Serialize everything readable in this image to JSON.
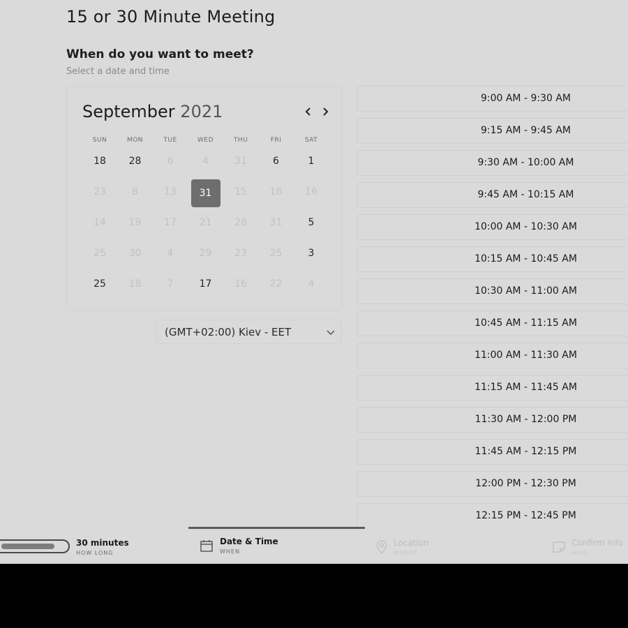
{
  "page": {
    "title": "15 or 30 Minute Meeting",
    "subtitle": "When do you want to meet?",
    "hint": "Select a date and time"
  },
  "calendar": {
    "month": "September",
    "year": "2021",
    "prev_icon": "chevron-left-icon",
    "next_icon": "chevron-right-icon",
    "days_of_week": [
      "SUN",
      "MON",
      "TUE",
      "WED",
      "THU",
      "FRI",
      "SAT"
    ],
    "weeks": [
      [
        {
          "label": "18",
          "state": "active"
        },
        {
          "label": "28",
          "state": "active"
        },
        {
          "label": "6",
          "state": "dim"
        },
        {
          "label": "4",
          "state": "dim"
        },
        {
          "label": "31",
          "state": "dim"
        },
        {
          "label": "6",
          "state": "active"
        },
        {
          "label": "1",
          "state": "active"
        }
      ],
      [
        {
          "label": "23",
          "state": "dim"
        },
        {
          "label": "8",
          "state": "dim"
        },
        {
          "label": "13",
          "state": "dim"
        },
        {
          "label": "31",
          "state": "selected"
        },
        {
          "label": "15",
          "state": "dim"
        },
        {
          "label": "16",
          "state": "dim"
        },
        {
          "label": "16",
          "state": "dim"
        }
      ],
      [
        {
          "label": "14",
          "state": "dim"
        },
        {
          "label": "19",
          "state": "dim"
        },
        {
          "label": "17",
          "state": "dim"
        },
        {
          "label": "21",
          "state": "dim"
        },
        {
          "label": "28",
          "state": "dim"
        },
        {
          "label": "31",
          "state": "dim"
        },
        {
          "label": "5",
          "state": "active"
        }
      ],
      [
        {
          "label": "25",
          "state": "dim"
        },
        {
          "label": "30",
          "state": "dim"
        },
        {
          "label": "4",
          "state": "dim"
        },
        {
          "label": "29",
          "state": "dim"
        },
        {
          "label": "23",
          "state": "dim"
        },
        {
          "label": "25",
          "state": "dim"
        },
        {
          "label": "3",
          "state": "active"
        }
      ],
      [
        {
          "label": "25",
          "state": "active"
        },
        {
          "label": "18",
          "state": "dim"
        },
        {
          "label": "7",
          "state": "dim"
        },
        {
          "label": "17",
          "state": "active"
        },
        {
          "label": "16",
          "state": "dim"
        },
        {
          "label": "22",
          "state": "dim"
        },
        {
          "label": "4",
          "state": "dim"
        }
      ]
    ]
  },
  "timezone": {
    "value": "(GMT+02:00) Kiev - EET",
    "icon": "chevron-down-icon"
  },
  "time_slots": [
    "9:00 AM - 9:30 AM",
    "9:15 AM - 9:45 AM",
    "9:30 AM - 10:00 AM",
    "9:45 AM - 10:15 AM",
    "10:00 AM - 10:30 AM",
    "10:15 AM - 10:45 AM",
    "10:30 AM - 11:00 AM",
    "10:45 AM - 11:15 AM",
    "11:00 AM - 11:30 AM",
    "11:15 AM - 11:45 AM",
    "11:30 AM - 12:00 PM",
    "11:45 AM - 12:15 PM",
    "12:00 PM - 12:30 PM",
    "12:15 PM - 12:45 PM"
  ],
  "steps": [
    {
      "label": "30 minutes",
      "sub": "HOW LONG",
      "icon": "progress-pill-icon",
      "state": "done"
    },
    {
      "label": "Date & Time",
      "sub": "WHEN",
      "icon": "calendar-icon",
      "state": "current"
    },
    {
      "label": "Location",
      "sub": "WHERE",
      "icon": "location-pin-icon",
      "state": "upcoming"
    },
    {
      "label": "Confirm Info",
      "sub": "WHO",
      "icon": "note-icon",
      "state": "upcoming"
    }
  ],
  "colors": {
    "background": "#dadada",
    "selected_day": "#6e6e6e",
    "active_text": "#262626",
    "dim_text": "#c2c2c2",
    "upcoming_step": "#bdbdbd"
  }
}
